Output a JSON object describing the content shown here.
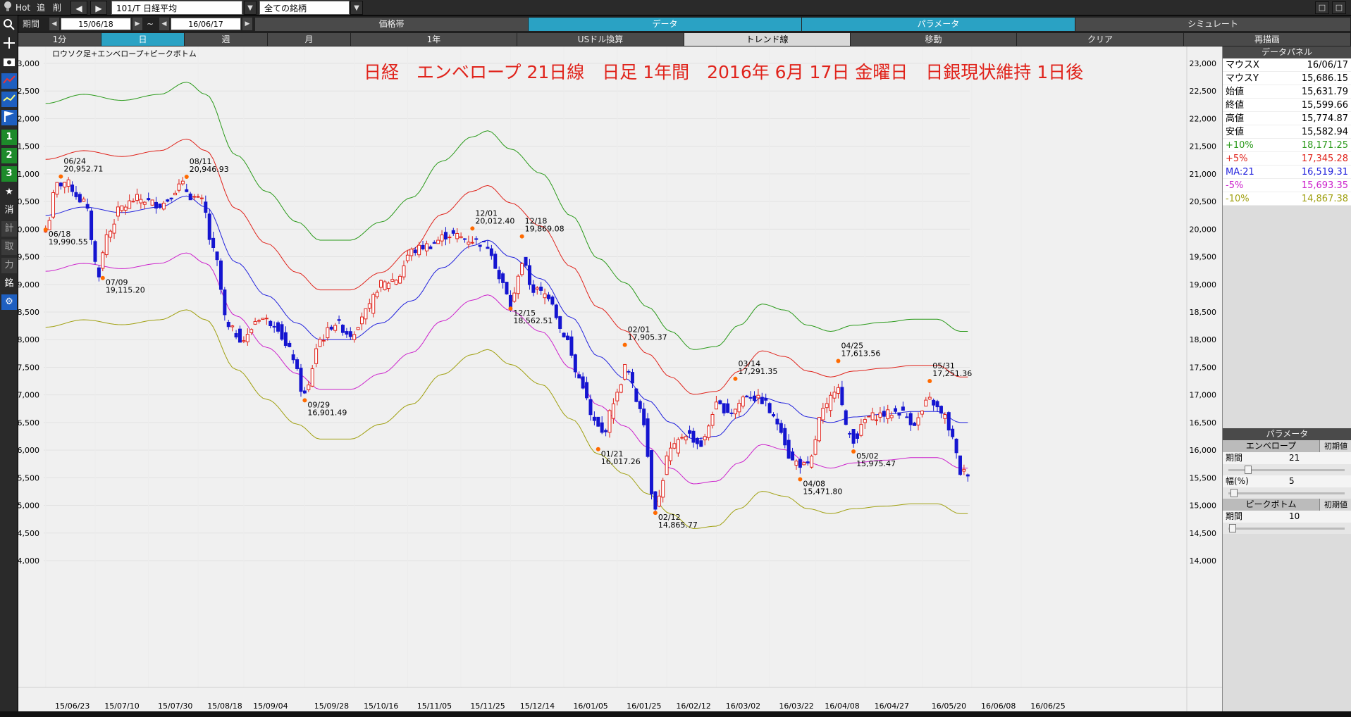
{
  "toolbar": {
    "hot_label": "Hot",
    "btn_add": "追",
    "btn_del": "削",
    "btn_prev": "◀",
    "btn_next": "▶",
    "symbol": "101/T 日経平均",
    "filter": "全ての銘柄",
    "win_btns": [
      "□",
      "□"
    ]
  },
  "period": {
    "label": "期間",
    "from": "15/06/18",
    "sep": "~",
    "to": "16/06/17"
  },
  "tabs_row2": [
    {
      "label": "価格帯",
      "active": false
    },
    {
      "label": "データ",
      "active": true
    },
    {
      "label": "パラメータ",
      "active": true
    },
    {
      "label": "シミュレート",
      "active": false
    }
  ],
  "tabs_row3": [
    {
      "label": "1分",
      "active": false
    },
    {
      "label": "日",
      "active": true
    },
    {
      "label": "週",
      "active": false
    },
    {
      "label": "月",
      "active": false
    },
    {
      "label": "1年",
      "active": false
    },
    {
      "label": "USドル換算",
      "active": false
    },
    {
      "label": "トレンド線",
      "active": false,
      "light": true
    },
    {
      "label": "移動",
      "active": false
    },
    {
      "label": "クリア",
      "active": false
    },
    {
      "label": "再描画",
      "active": false
    }
  ],
  "sidebar": {
    "icons": [
      "search-icon",
      "crosshair-icon",
      "camera-icon",
      "line-chart-icon",
      "indicator-icon",
      "flag-icon"
    ],
    "nums": [
      "1",
      "2",
      "3"
    ],
    "star": "★",
    "chars": [
      "消",
      "計",
      "取",
      "力",
      "銘"
    ],
    "gear": "⚙"
  },
  "chart_data": {
    "type": "candlestick",
    "subtitle": "ロウソク足+エンベロープ+ピークボトム",
    "title": "日経　エンベロープ 21日線　日足 1年間　2016年 6月 17日 金曜日　日銀現状維持 1日後",
    "ylim": [
      14000,
      23000
    ],
    "yticks": [
      "23,000",
      "22,500",
      "22,000",
      "21,500",
      "21,000",
      "20,500",
      "20,000",
      "19,500",
      "19,000",
      "18,500",
      "18,000",
      "17,500",
      "17,000",
      "16,500",
      "16,000",
      "15,500",
      "15,000",
      "14,500",
      "14,000"
    ],
    "xticks": [
      "15/06/23",
      "15/07/10",
      "15/07/30",
      "15/08/18",
      "15/09/04",
      "15/09/28",
      "15/10/16",
      "15/11/05",
      "15/11/25",
      "15/12/14",
      "16/01/05",
      "16/01/25",
      "16/02/12",
      "16/03/02",
      "16/03/22",
      "16/04/08",
      "16/04/27",
      "16/05/20",
      "16/06/08",
      "16/06/25"
    ],
    "peaks": [
      {
        "date": "06/24",
        "value": "20,952.71",
        "idx": 4,
        "price": 20952.71,
        "pos": "top"
      },
      {
        "date": "06/18",
        "value": "19,990.55",
        "idx": 0,
        "price": 19990.55,
        "pos": "bottom"
      },
      {
        "date": "07/09",
        "value": "19,115.20",
        "idx": 15,
        "price": 19115.2,
        "pos": "bottom"
      },
      {
        "date": "08/11",
        "value": "20,946.93",
        "idx": 37,
        "price": 20946.93,
        "pos": "top"
      },
      {
        "date": "09/29",
        "value": "16,901.49",
        "idx": 68,
        "price": 16901.49,
        "pos": "bottom"
      },
      {
        "date": "12/01",
        "value": "20,012.40",
        "idx": 112,
        "price": 20012.4,
        "pos": "top"
      },
      {
        "date": "12/15",
        "value": "18,562.51",
        "idx": 122,
        "price": 18562.51,
        "pos": "bottom"
      },
      {
        "date": "12/18",
        "value": "19,869.08",
        "idx": 125,
        "price": 19869.08,
        "pos": "top"
      },
      {
        "date": "01/21",
        "value": "16,017.26",
        "idx": 145,
        "price": 16017.26,
        "pos": "bottom"
      },
      {
        "date": "02/01",
        "value": "17,905.37",
        "idx": 152,
        "price": 17905.37,
        "pos": "top"
      },
      {
        "date": "02/12",
        "value": "14,865.77",
        "idx": 160,
        "price": 14865.77,
        "pos": "bottom"
      },
      {
        "date": "03/14",
        "value": "17,291.35",
        "idx": 181,
        "price": 17291.35,
        "pos": "top"
      },
      {
        "date": "04/08",
        "value": "15,471.80",
        "idx": 198,
        "price": 15471.8,
        "pos": "bottom"
      },
      {
        "date": "04/25",
        "value": "17,613.56",
        "idx": 208,
        "price": 17613.56,
        "pos": "top"
      },
      {
        "date": "05/02",
        "value": "15,975.47",
        "idx": 212,
        "price": 15975.47,
        "pos": "bottom"
      },
      {
        "date": "05/31",
        "value": "17,251.36",
        "idx": 232,
        "price": 17251.36,
        "pos": "top"
      }
    ],
    "ma_anchors": [
      [
        0,
        20250
      ],
      [
        10,
        20400
      ],
      [
        20,
        20300
      ],
      [
        30,
        20400
      ],
      [
        37,
        20600
      ],
      [
        42,
        20400
      ],
      [
        50,
        19400
      ],
      [
        58,
        18800
      ],
      [
        66,
        18300
      ],
      [
        72,
        18000
      ],
      [
        80,
        18000
      ],
      [
        88,
        18300
      ],
      [
        96,
        18700
      ],
      [
        104,
        19300
      ],
      [
        112,
        19700
      ],
      [
        116,
        19800
      ],
      [
        122,
        19500
      ],
      [
        130,
        19100
      ],
      [
        138,
        18400
      ],
      [
        145,
        17700
      ],
      [
        152,
        17300
      ],
      [
        158,
        16900
      ],
      [
        164,
        16500
      ],
      [
        170,
        16200
      ],
      [
        176,
        16250
      ],
      [
        182,
        16600
      ],
      [
        188,
        16950
      ],
      [
        194,
        16850
      ],
      [
        200,
        16600
      ],
      [
        206,
        16500
      ],
      [
        212,
        16600
      ],
      [
        220,
        16650
      ],
      [
        228,
        16700
      ],
      [
        234,
        16700
      ],
      [
        240,
        16500
      ]
    ],
    "candles_close_anchors": [
      [
        0,
        20000
      ],
      [
        3,
        20800
      ],
      [
        5,
        20850
      ],
      [
        10,
        20500
      ],
      [
        14,
        19200
      ],
      [
        16,
        19900
      ],
      [
        20,
        20400
      ],
      [
        24,
        20550
      ],
      [
        30,
        20450
      ],
      [
        36,
        20800
      ],
      [
        38,
        20600
      ],
      [
        41,
        20500
      ],
      [
        44,
        19600
      ],
      [
        48,
        18200
      ],
      [
        52,
        18000
      ],
      [
        56,
        18400
      ],
      [
        60,
        18300
      ],
      [
        64,
        17800
      ],
      [
        68,
        17000
      ],
      [
        72,
        18000
      ],
      [
        76,
        18300
      ],
      [
        80,
        18100
      ],
      [
        84,
        18500
      ],
      [
        88,
        19000
      ],
      [
        92,
        19100
      ],
      [
        96,
        19600
      ],
      [
        100,
        19700
      ],
      [
        106,
        19900
      ],
      [
        112,
        19800
      ],
      [
        116,
        19700
      ],
      [
        120,
        19000
      ],
      [
        122,
        18600
      ],
      [
        125,
        19400
      ],
      [
        128,
        18900
      ],
      [
        132,
        18800
      ],
      [
        136,
        18100
      ],
      [
        140,
        17300
      ],
      [
        144,
        16500
      ],
      [
        146,
        16300
      ],
      [
        150,
        17000
      ],
      [
        152,
        17500
      ],
      [
        156,
        16800
      ],
      [
        160,
        15000
      ],
      [
        164,
        16000
      ],
      [
        168,
        16300
      ],
      [
        172,
        16100
      ],
      [
        176,
        16800
      ],
      [
        180,
        16700
      ],
      [
        184,
        17000
      ],
      [
        188,
        16900
      ],
      [
        192,
        16500
      ],
      [
        196,
        15800
      ],
      [
        200,
        15700
      ],
      [
        204,
        16700
      ],
      [
        208,
        17200
      ],
      [
        210,
        16400
      ],
      [
        212,
        16200
      ],
      [
        216,
        16600
      ],
      [
        220,
        16650
      ],
      [
        224,
        16700
      ],
      [
        228,
        16500
      ],
      [
        232,
        16900
      ],
      [
        236,
        16600
      ],
      [
        238,
        16200
      ],
      [
        240,
        15600
      ]
    ],
    "series": [
      {
        "name": "+10%",
        "mult": 1.1,
        "color": "#2a9a1a"
      },
      {
        "name": "+5%",
        "mult": 1.05,
        "color": "#e0231b"
      },
      {
        "name": "MA:21",
        "mult": 1.0,
        "color": "#2222dd"
      },
      {
        "name": "-5%",
        "mult": 0.95,
        "color": "#cc22cc"
      },
      {
        "name": "-10%",
        "mult": 0.9,
        "color": "#a0a010"
      }
    ]
  },
  "data_panel": {
    "title": "データパネル",
    "rows": [
      {
        "label": "マウスX",
        "value": "16/06/17",
        "color": "#000"
      },
      {
        "label": "マウスY",
        "value": "15,686.15",
        "color": "#000"
      },
      {
        "label": "始値",
        "value": "15,631.79",
        "color": "#000"
      },
      {
        "label": "終値",
        "value": "15,599.66",
        "color": "#000"
      },
      {
        "label": "高値",
        "value": "15,774.87",
        "color": "#000"
      },
      {
        "label": "安値",
        "value": "15,582.94",
        "color": "#000"
      },
      {
        "label": "+10%",
        "value": "18,171.25",
        "color": "#2a9a1a"
      },
      {
        "label": "+5%",
        "value": "17,345.28",
        "color": "#e0231b"
      },
      {
        "label": "MA:21",
        "value": "16,519.31",
        "color": "#2222dd"
      },
      {
        "label": "-5%",
        "value": "15,693.35",
        "color": "#cc22cc"
      },
      {
        "label": "-10%",
        "value": "14,867.38",
        "color": "#a0a010"
      }
    ]
  },
  "params": {
    "title": "パラメータ",
    "env": {
      "name": "エンベロープ",
      "reset": "初期値",
      "period_label": "期間",
      "period": "21",
      "width_label": "幅(%)",
      "width": "5",
      "period_fill": 0.18,
      "width_fill": 0.05
    },
    "pb": {
      "name": "ピークボトム",
      "reset": "初期値",
      "period_label": "期間",
      "period": "10",
      "period_fill": 0.04
    }
  }
}
